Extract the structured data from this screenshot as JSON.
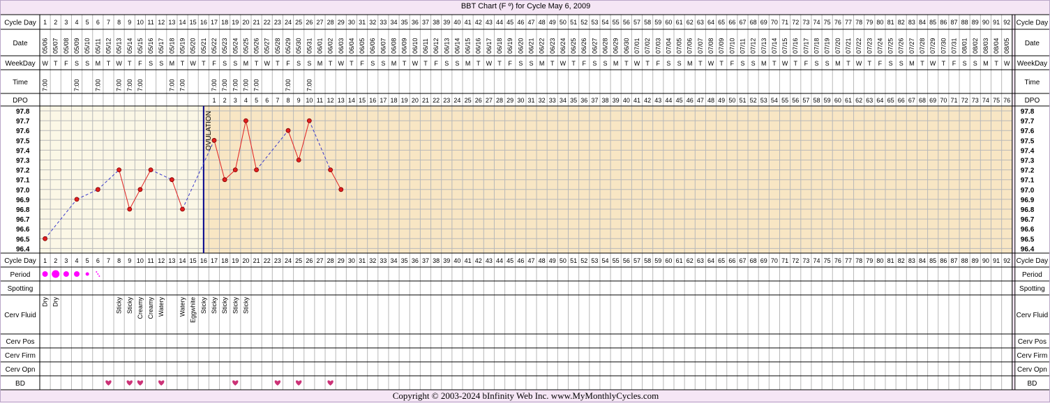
{
  "title": "BBT Chart (F º) for Cycle May 6, 2009",
  "footer": "Copyright © 2003-2024 bInfinity Web Inc.     www.MyMonthlyCycles.com",
  "row_labels": {
    "cycle_day": "Cycle Day",
    "date": "Date",
    "weekday": "WeekDay",
    "time": "Time",
    "dpo": "DPO",
    "period": "Period",
    "spotting": "Spotting",
    "cerv_fluid": "Cerv Fluid",
    "cerv_pos": "Cerv Pos",
    "cerv_firm": "Cerv Firm",
    "cerv_opn": "Cerv Opn",
    "bd": "BD"
  },
  "ovulation_label": "OVULATION",
  "colors": {
    "pre_ovulation_bg": "#fbf7e6",
    "post_ovulation_bg": "#f8e6c4",
    "grid": "#b8b8b8",
    "temp_line": "#e02020",
    "temp_dash": "#3a3acc",
    "ovulation_line": "#00008b",
    "period": "#ff00ff",
    "bd_heart": "#cc3377",
    "page_bg": "#f5e6f5"
  },
  "chart_data": {
    "type": "line",
    "title": "BBT Chart (F º) for Cycle May 6, 2009",
    "x_label": "Cycle Day",
    "y_label": "",
    "cycle_days": [
      1,
      2,
      3,
      4,
      5,
      6,
      7,
      8,
      9,
      10,
      11,
      12,
      13,
      14,
      15,
      16,
      17,
      18,
      19,
      20,
      21,
      22,
      23,
      24,
      25,
      26,
      27,
      28,
      29,
      30,
      31,
      32,
      33,
      34,
      35,
      36,
      37,
      38,
      39,
      40,
      41,
      42,
      43,
      44,
      45,
      46,
      47,
      48,
      49,
      50,
      51,
      52,
      53,
      54,
      55,
      56,
      57,
      58,
      59,
      60,
      61,
      62,
      63,
      64,
      65,
      66,
      67,
      68,
      69,
      70,
      71,
      72,
      73,
      74,
      75,
      76,
      77,
      78,
      79,
      80,
      81,
      82,
      83,
      84,
      85,
      86,
      87,
      88,
      89,
      90,
      91,
      92
    ],
    "dates": [
      "05/06",
      "05/07",
      "05/08",
      "05/09",
      "05/10",
      "05/11",
      "05/12",
      "05/13",
      "05/14",
      "05/15",
      "05/16",
      "05/17",
      "05/18",
      "05/19",
      "05/20",
      "05/21",
      "05/22",
      "05/23",
      "05/24",
      "05/25",
      "05/26",
      "05/27",
      "05/28",
      "05/29",
      "05/30",
      "05/31",
      "06/01",
      "06/02",
      "06/03",
      "06/04",
      "06/05",
      "06/06",
      "06/07",
      "06/08",
      "06/09",
      "06/10",
      "06/11",
      "06/12",
      "06/13",
      "06/14",
      "06/15",
      "06/16",
      "06/17",
      "06/18",
      "06/19",
      "06/20",
      "06/21",
      "06/22",
      "06/23",
      "06/24",
      "06/25",
      "06/26",
      "06/27",
      "06/28",
      "06/29",
      "06/30",
      "07/01",
      "07/02",
      "07/03",
      "07/04",
      "07/05",
      "07/06",
      "07/07",
      "07/08",
      "07/09",
      "07/10",
      "07/11",
      "07/12",
      "07/13",
      "07/14",
      "07/15",
      "07/16",
      "07/17",
      "07/18",
      "07/19",
      "07/20",
      "07/21",
      "07/22",
      "07/23",
      "07/24",
      "07/25",
      "07/26",
      "07/27",
      "07/28",
      "07/29",
      "07/30",
      "07/31",
      "08/01",
      "08/02",
      "08/03",
      "08/04",
      "08/05"
    ],
    "weekdays": [
      "W",
      "T",
      "F",
      "S",
      "S",
      "M",
      "T",
      "W",
      "T",
      "F",
      "S",
      "S",
      "M",
      "T",
      "W",
      "T",
      "F",
      "S",
      "S",
      "M",
      "T",
      "W",
      "T",
      "F",
      "S",
      "S",
      "M",
      "T",
      "W",
      "T",
      "F",
      "S",
      "S",
      "M",
      "T",
      "W",
      "T",
      "F",
      "S",
      "S",
      "M",
      "T",
      "W",
      "T",
      "F",
      "S",
      "S",
      "M",
      "T",
      "W",
      "T",
      "F",
      "S",
      "S",
      "M",
      "T",
      "W",
      "T",
      "F",
      "S",
      "S",
      "M",
      "T",
      "W",
      "T",
      "F",
      "S",
      "S",
      "M",
      "T",
      "W",
      "T",
      "F",
      "S",
      "S",
      "M",
      "T",
      "W",
      "T",
      "F",
      "S",
      "S",
      "M",
      "T",
      "W",
      "T",
      "F",
      "S",
      "S",
      "M",
      "T",
      "W"
    ],
    "times": [
      "7:00",
      "",
      "",
      "7:00",
      "",
      "7:00",
      "",
      "7:00",
      "7:00",
      "7:00",
      "",
      "",
      "7:00",
      "7:00",
      "",
      "",
      "7:00",
      "7:00",
      "7:00",
      "7:00",
      "7:00",
      "",
      "",
      "7:00",
      "",
      "7:00",
      "",
      "",
      "",
      "",
      "",
      "",
      "",
      "",
      "",
      "",
      "",
      "",
      "",
      "",
      "",
      "",
      "",
      "",
      "",
      "",
      "",
      "",
      "",
      "",
      "",
      "",
      "",
      "",
      "",
      "",
      "",
      "",
      "",
      "",
      "",
      "",
      "",
      "",
      "",
      "",
      "",
      "",
      "",
      "",
      "",
      "",
      "",
      "",
      "",
      "",
      "",
      "",
      "",
      "",
      "",
      "",
      "",
      "",
      "",
      "",
      "",
      "",
      "",
      "",
      "",
      ""
    ],
    "dpo_start_day": 17,
    "dpo_count": 76,
    "ovulation_day": 16,
    "y_ticks": [
      "97.8",
      "97.7",
      "97.6",
      "97.5",
      "97.4",
      "97.3",
      "97.2",
      "97.1",
      "97.0",
      "96.9",
      "96.8",
      "96.7",
      "96.6",
      "96.5",
      "96.4"
    ],
    "y_range": [
      96.4,
      97.8
    ],
    "temperatures": [
      {
        "day": 1,
        "temp": 96.5
      },
      {
        "day": 4,
        "temp": 96.9
      },
      {
        "day": 6,
        "temp": 97.0
      },
      {
        "day": 8,
        "temp": 97.2
      },
      {
        "day": 9,
        "temp": 96.8
      },
      {
        "day": 10,
        "temp": 97.0
      },
      {
        "day": 11,
        "temp": 97.2
      },
      {
        "day": 13,
        "temp": 97.1
      },
      {
        "day": 14,
        "temp": 96.8
      },
      {
        "day": 17,
        "temp": 97.5
      },
      {
        "day": 18,
        "temp": 97.1
      },
      {
        "day": 19,
        "temp": 97.2
      },
      {
        "day": 20,
        "temp": 97.7
      },
      {
        "day": 21,
        "temp": 97.2
      },
      {
        "day": 24,
        "temp": 97.6
      },
      {
        "day": 25,
        "temp": 97.3
      },
      {
        "day": 26,
        "temp": 97.7
      },
      {
        "day": 28,
        "temp": 97.2
      },
      {
        "day": 29,
        "temp": 97.0
      }
    ],
    "period": [
      {
        "day": 1,
        "level": "medium"
      },
      {
        "day": 2,
        "level": "heavy"
      },
      {
        "day": 3,
        "level": "medium"
      },
      {
        "day": 4,
        "level": "medium"
      },
      {
        "day": 5,
        "level": "light"
      },
      {
        "day": 6,
        "level": "spotting"
      }
    ],
    "cervical_fluid": [
      {
        "day": 1,
        "value": "Dry"
      },
      {
        "day": 2,
        "value": "Dry"
      },
      {
        "day": 8,
        "value": "Sticky"
      },
      {
        "day": 9,
        "value": "Sticky"
      },
      {
        "day": 10,
        "value": "Creamy"
      },
      {
        "day": 11,
        "value": "Creamy"
      },
      {
        "day": 12,
        "value": "Watery"
      },
      {
        "day": 14,
        "value": "Watery"
      },
      {
        "day": 15,
        "value": "Eggwhite"
      },
      {
        "day": 16,
        "value": "Sticky"
      },
      {
        "day": 17,
        "value": "Sticky"
      },
      {
        "day": 18,
        "value": "Sticky"
      },
      {
        "day": 19,
        "value": "Sticky"
      },
      {
        "day": 20,
        "value": "Sticky"
      }
    ],
    "bd_days": [
      7,
      9,
      10,
      12,
      19,
      23,
      25,
      28
    ]
  }
}
